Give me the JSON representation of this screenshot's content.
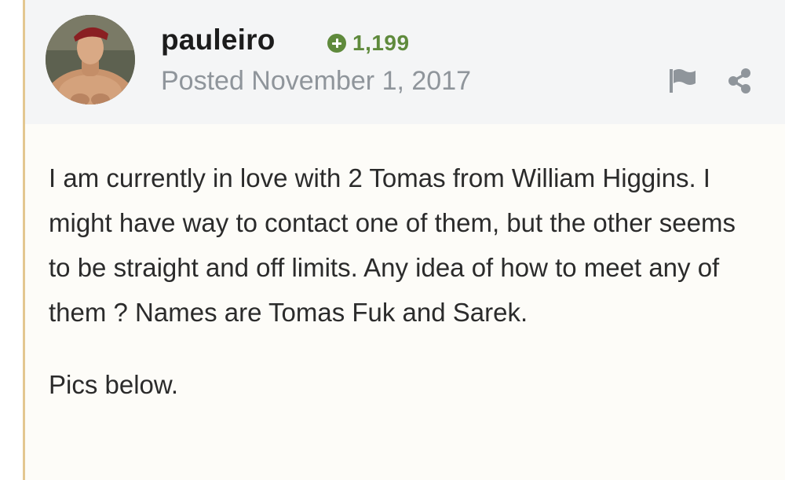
{
  "author": {
    "username": "pauleiro",
    "reputation": "1,199",
    "posted_label": "Posted November 1, 2017"
  },
  "icons": {
    "reputation": "plus-circle-icon",
    "report": "flag-icon",
    "share": "share-icon"
  },
  "body": {
    "paragraphs": [
      "I am currently in love with 2 Tomas from William Higgins. I might have way to contact one of them, but the other seems to be straight and off limits. Any idea of how to meet any of them ? Names are Tomas Fuk and Sarek.",
      "Pics below."
    ]
  },
  "colors": {
    "reputation_green": "#5f8a3c",
    "header_bg": "#f4f5f6",
    "body_bg": "#fdfcf8",
    "accent_rule": "#e3c790",
    "meta_gray": "#8f959b"
  }
}
